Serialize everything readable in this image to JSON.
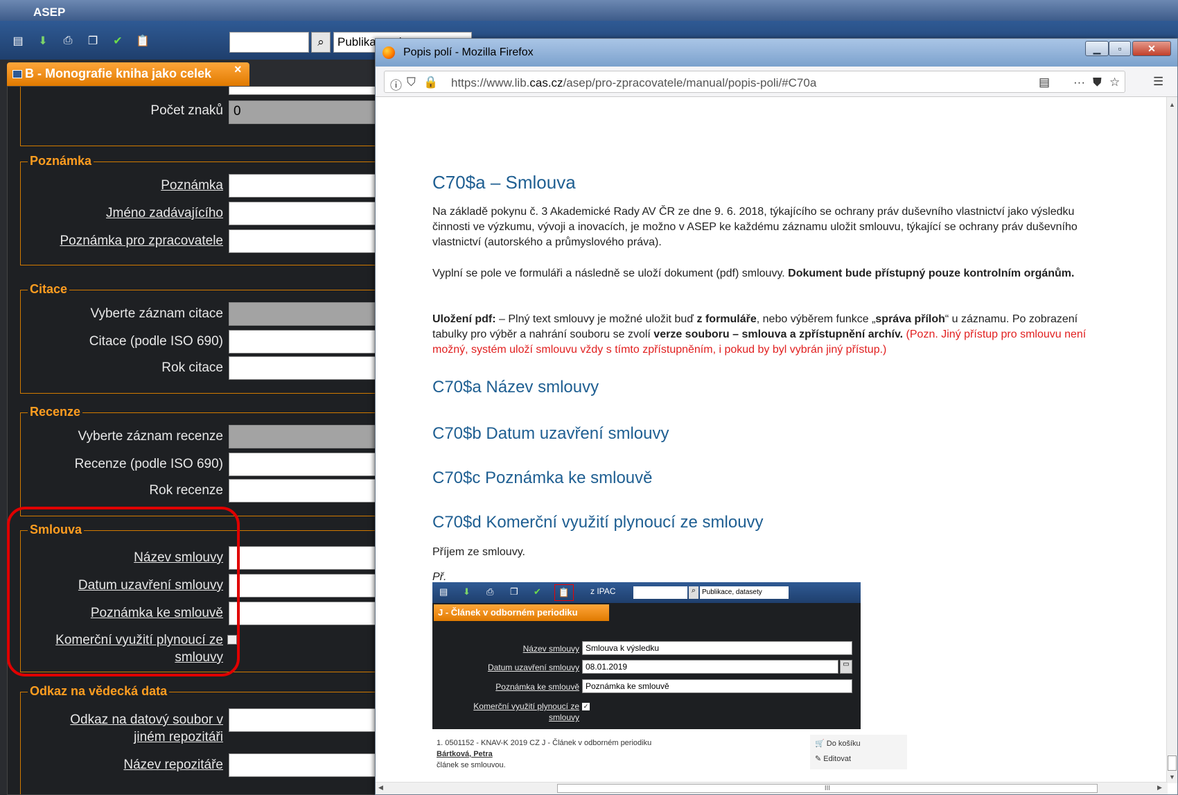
{
  "asep": {
    "title": "ASEP",
    "search_value": "",
    "publication_select": "Publikace, datasety",
    "toolbar_icons": [
      "list-icon",
      "download-icon",
      "print-icon",
      "copy-icon",
      "check-icon",
      "clipboard-icon"
    ]
  },
  "form_tab": {
    "label": "B - Monografie kniha jako celek",
    "close": "×"
  },
  "form": {
    "pocet_znaku_label": "Počet znaků",
    "pocet_znaku_value": "0",
    "poznamka": {
      "title": "Poznámka",
      "fields": [
        "Poznámka",
        "Jméno zadávajícího",
        "Poznámka pro zpracovatele"
      ]
    },
    "citace": {
      "title": "Citace",
      "fields": [
        "Vyberte záznam citace",
        "Citace (podle ISO 690)",
        "Rok citace"
      ]
    },
    "recenze": {
      "title": "Recenze",
      "fields": [
        "Vyberte záznam recenze",
        "Recenze (podle ISO 690)",
        "Rok recenze"
      ]
    },
    "smlouva": {
      "title": "Smlouva",
      "fields": [
        "Název smlouvy",
        "Datum uzavření smlouvy",
        "Poznámka ke smlouvě"
      ],
      "checkbox_line1": "Komerční využití plynoucí ze",
      "checkbox_line2": "smlouvy"
    },
    "odkaz": {
      "title": "Odkaz na vědecká data",
      "field1_line1": "Odkaz na datový soubor v",
      "field1_line2": "jiném repozitáři",
      "field2": "Název repozitáře"
    }
  },
  "firefox": {
    "window_title": "Popis polí - Mozilla Firefox",
    "url_prefix": "https://www.lib.",
    "url_domain": "cas.cz",
    "url_suffix": "/asep/pro-zpracovatele/manual/popis-poli/#C70a",
    "page": {
      "h1": "C70$a – Smlouva",
      "p1": "Na základě pokynu č. 3 Akademické Rady AV ČR  ze dne 9. 6. 2018, týkajícího se ochrany práv duševního vlastnictví jako výsledku činnosti ve výzkumu, vývoji a inovacích, je možno v ASEP ke každému záznamu uložit smlouvu, týkající se ochrany práv duševního vlastnictví (autorského a průmyslového práva).",
      "p2_normal": "Vyplní se pole ve formuláři a následně se uloží dokument (pdf) smlouvy. ",
      "p2_bold": "Dokument bude přístupný pouze kontrolním orgánům.",
      "p3_bold1": "Uložení pdf:",
      "p3_text1": " – Plný text smlouvy je možné uložit buď ",
      "p3_bold2": "z formuláře",
      "p3_text2": ", nebo výběrem funkce „",
      "p3_bold3": "správa příloh",
      "p3_text3": "“ u záznamu. Po zobrazení tabulky pro výběr a nahrání souboru se zvolí ",
      "p3_bold4": "verze souboru – smlouva a zpřístupnění  archív.",
      "p3_red": " (Pozn. Jiný přístup pro smlouvu není možný, systém uloží smlouvu vždy s tímto zpřístupněním, i pokud by byl vybrán jiný přístup.)",
      "h2": "C70$a Název smlouvy",
      "h3": "C70$b Datum uzavření smlouvy",
      "h4": "C70$c Poznámka ke smlouvě",
      "h5": "C70$d Komerční využití plynoucí ze smlouvy",
      "p4": "Příjem ze smlouvy.",
      "p5": "Př."
    },
    "embedded": {
      "ipac_label": "z IPAC",
      "select": "Publikace, datasety",
      "tab": "J - Článek v odborném periodiku",
      "labels": [
        "Název smlouvy",
        "Datum uzavření smlouvy",
        "Poznámka ke smlouvě"
      ],
      "values": [
        "Smlouva k výsledku",
        "08.01.2019",
        "Poznámka ke smlouvě"
      ],
      "checkbox_line1": "Komerční využití plynoucí ze",
      "checkbox_line2": "smlouvy",
      "result_line": "1. 0501152 - KNAV-K 2019 CZ J - Článek v odborném periodiku",
      "result_author": "Bártková, Petra",
      "result_note": "článek se smlouvou.",
      "action_cart": "Do košíku",
      "action_edit": "Editovat"
    },
    "hscroll_mark": "III"
  }
}
